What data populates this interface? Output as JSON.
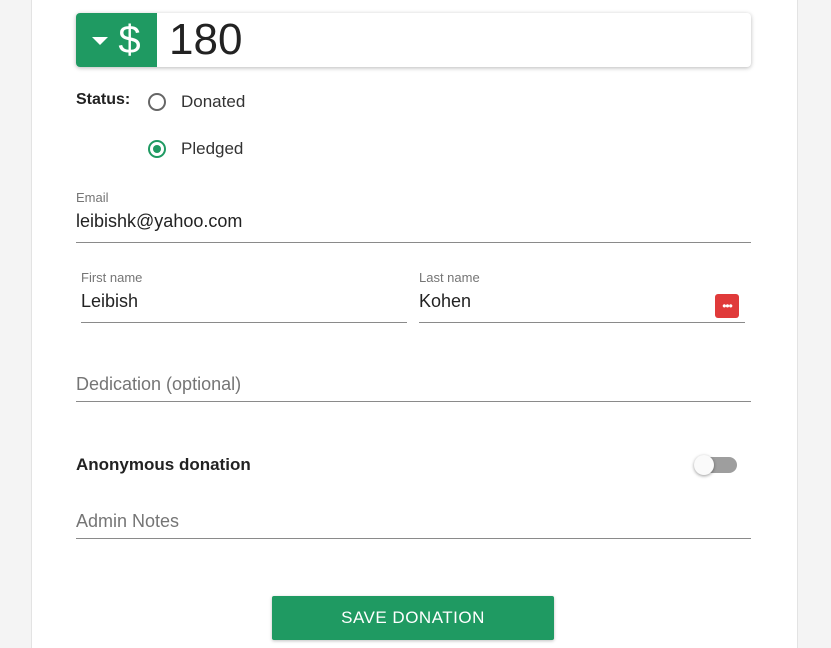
{
  "amount": {
    "currency_symbol": "$",
    "value": "180"
  },
  "status": {
    "label": "Status:",
    "options": [
      {
        "label": "Donated",
        "selected": false
      },
      {
        "label": "Pledged",
        "selected": true
      }
    ]
  },
  "email": {
    "label": "Email",
    "value": "leibishk@yahoo.com"
  },
  "first_name": {
    "label": "First name",
    "value": "Leibish"
  },
  "last_name": {
    "label": "Last name",
    "value": "Kohen"
  },
  "dedication": {
    "placeholder": "Dedication (optional)"
  },
  "anonymous": {
    "label": "Anonymous donation",
    "enabled": false
  },
  "admin_notes": {
    "placeholder": "Admin Notes"
  },
  "save_button": {
    "label": "SAVE DONATION"
  },
  "colors": {
    "accent": "#1f9a62",
    "password_manager": "#e03a3a"
  }
}
